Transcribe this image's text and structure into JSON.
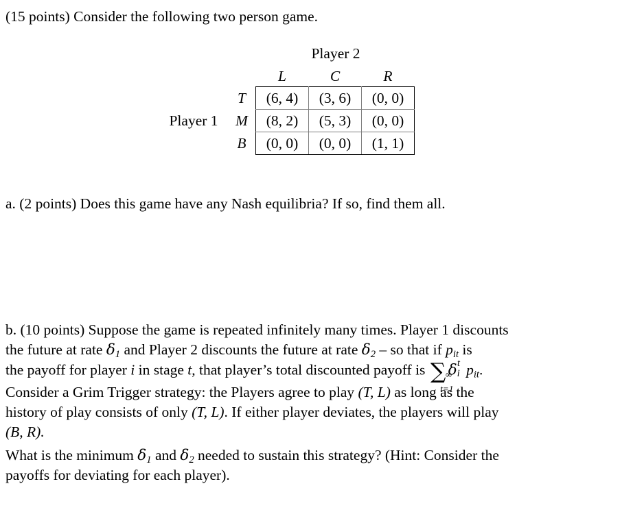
{
  "document": {
    "intro": "(15 points) Consider the following two person game.",
    "matrix": {
      "player2_label": "Player 2",
      "player1_label": "Player 1",
      "column_headers": [
        "L",
        "C",
        "R"
      ],
      "row_headers": [
        "T",
        "M",
        "B"
      ],
      "cells": [
        [
          "(6, 4)",
          "(3, 6)",
          "(0, 0)"
        ],
        [
          "(8, 2)",
          "(5, 3)",
          "(0, 0)"
        ],
        [
          "(0, 0)",
          "(0, 0)",
          "(1, 1)"
        ]
      ],
      "payoffs": [
        [
          [
            6,
            4
          ],
          [
            3,
            6
          ],
          [
            0,
            0
          ]
        ],
        [
          [
            8,
            2
          ],
          [
            5,
            3
          ],
          [
            0,
            0
          ]
        ],
        [
          [
            0,
            0
          ],
          [
            0,
            0
          ],
          [
            1,
            1
          ]
        ]
      ]
    },
    "part_a": {
      "marker": "a.",
      "points": "(2 points)",
      "text": "Does this game have any Nash equilibria?  If so, find them all.",
      "full": "a. (2 points) Does this game have any Nash equilibria?  If so, find them all."
    },
    "part_b": {
      "marker": "b.",
      "points": "(10 points)",
      "line1_pre": "b. (10 points) Suppose the game is repeated infinitely many times.  Player 1 discounts",
      "line2_a": "the future at rate ",
      "delta1": "δ",
      "delta1_sub": "1",
      "line2_b": " and Player 2 discounts the future at rate ",
      "delta2": "δ",
      "delta2_sub": "2",
      "line2_c": " – so that if ",
      "p_var": "p",
      "p_sub": "it",
      "line2_d": " is",
      "line3_a": "the payoff for player ",
      "i_var": "i",
      "line3_b": " in stage ",
      "t_var": "t",
      "line3_c": ", that player’s total discounted payoff is ",
      "sigma": "∑",
      "sum_upper": "∞",
      "sum_lower": "t=1",
      "delta_i_t_base": "δ",
      "delta_i_t_sup": "t",
      "delta_i_t_sub": "i",
      "p_it_base": "p",
      "p_it_sub": "it",
      "line3_end": ".",
      "line4_a": "Consider a Grim Trigger strategy:  the Players agree to play ",
      "TL": "(T, L)",
      "line4_b": " as long as the",
      "line5_a": "history of play consists of only ",
      "TL2": "(T, L)",
      "line5_b": ".  If either player deviates, the players will play",
      "line6": "(B, R).",
      "para2_line1_a": "What is the minimum ",
      "para2_delta1": "δ",
      "para2_delta1_sub": "1",
      "para2_line1_b": " and ",
      "para2_delta2": "δ",
      "para2_delta2_sub": "2",
      "para2_line1_c": " needed to sustain this strategy?  (Hint: Consider the",
      "para2_line2": "payoffs for deviating for each player)."
    }
  }
}
